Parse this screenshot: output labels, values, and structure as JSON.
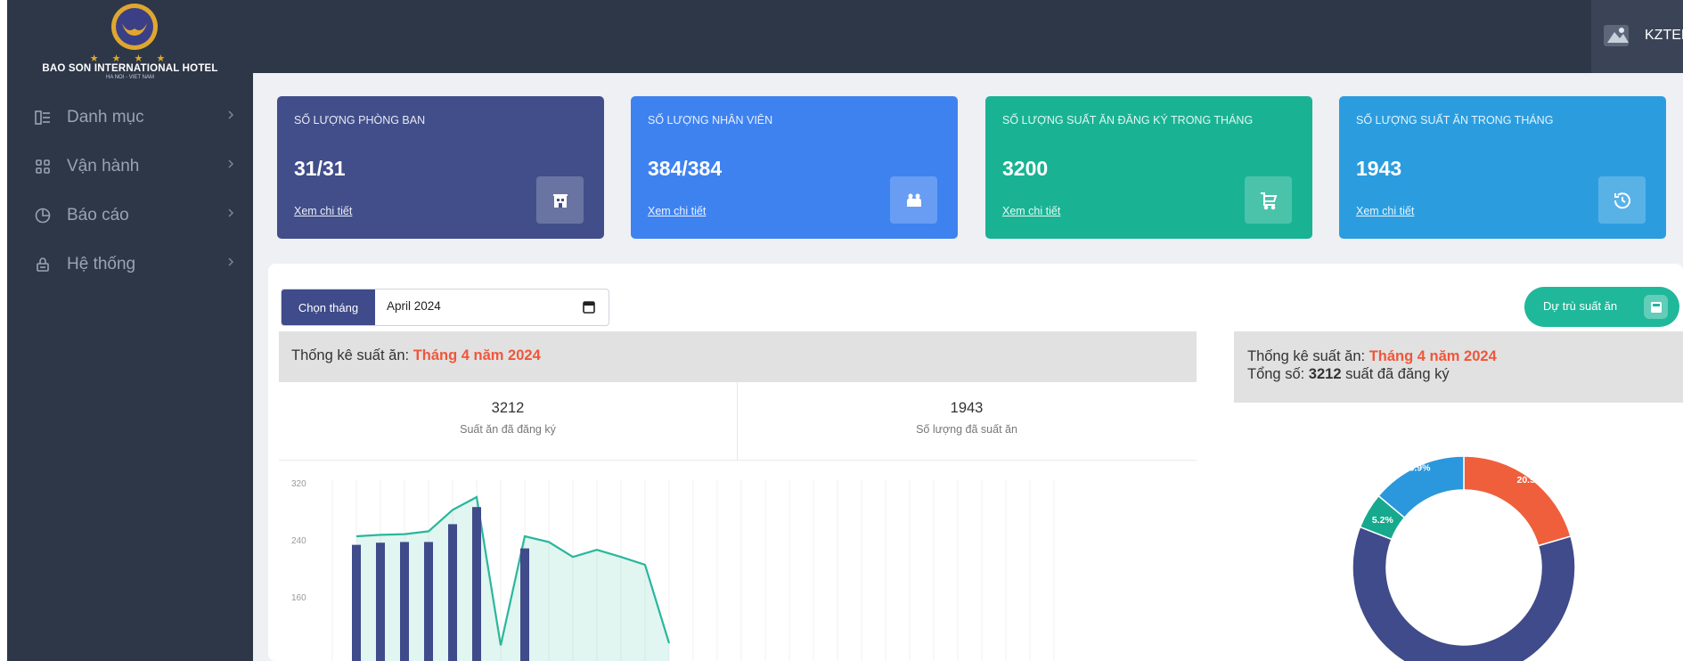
{
  "sidebar": {
    "logo": {
      "name": "BAO SON INTERNATIONAL HOTEL",
      "subtitle": "HA NOI - VIET NAM",
      "stars": "★ ★ ★ ★"
    },
    "items": [
      {
        "label": "Danh mục",
        "icon": "list-icon"
      },
      {
        "label": "Vận hành",
        "icon": "grid-icon"
      },
      {
        "label": "Báo cáo",
        "icon": "pie-chart-icon"
      },
      {
        "label": "Hệ thống",
        "icon": "lock-icon"
      }
    ]
  },
  "topbar": {
    "user_name": "KZTEK"
  },
  "cards": [
    {
      "title": "SỐ LƯỢNG PHÒNG BAN",
      "value": "31/31",
      "link": "Xem chi tiết",
      "icon": "building-icon",
      "color": "#414e8a"
    },
    {
      "title": "SỐ LƯỢNG NHÂN VIÊN",
      "value": "384/384",
      "link": "Xem chi tiết",
      "icon": "people-icon",
      "color": "#3e82f0"
    },
    {
      "title": "SỐ LƯỢNG SUẤT ĂN ĐĂNG KÝ TRONG THÁNG",
      "value": "3200",
      "link": "Xem chi tiết",
      "icon": "cart-icon",
      "color": "#19b394"
    },
    {
      "title": "SỐ LƯỢNG SUẤT ĂN TRONG THÁNG",
      "value": "1943",
      "link": "Xem chi tiết",
      "icon": "history-icon",
      "color": "#2b9ddf"
    }
  ],
  "filter": {
    "label": "Chọn tháng",
    "value": "April 2024"
  },
  "reserve_button": {
    "label": "Dự trù suất ăn"
  },
  "stats": {
    "title_prefix": "Thống kê suất ăn: ",
    "title_highlight": "Tháng 4 năm 2024",
    "registered_value": "3212",
    "registered_label": "Suất ăn đã đăng ký",
    "served_value": "1943",
    "served_label": "Số lượng đã suất ăn"
  },
  "pie_panel": {
    "title_prefix": "Thống kê suất ăn: ",
    "title_highlight": "Tháng 4 năm 2024",
    "total_prefix": "Tổng số: ",
    "total_value": "3212",
    "total_suffix": " suất đã đăng ký"
  },
  "chart_data": [
    {
      "type": "bar",
      "y_ticks": [
        "320",
        "240",
        "160"
      ],
      "ylim": [
        100,
        320
      ],
      "grid": true,
      "series": [
        {
          "type": "bar",
          "color": "#3f4b8a",
          "values": [
            233,
            236,
            237,
            237,
            262,
            286,
            0,
            228
          ]
        },
        {
          "type": "area",
          "color": "#2ab79b",
          "values": [
            null,
            245,
            247,
            248,
            252,
            282,
            300,
            92,
            245,
            237,
            216,
            226,
            216,
            205,
            95
          ]
        }
      ]
    },
    {
      "type": "pie",
      "style": "donut",
      "slices": [
        {
          "label": "20.5%",
          "value": 20.5,
          "color": "#ef5f3c"
        },
        {
          "label": "60.5%",
          "value": 60.5,
          "color": "#3f4b8a"
        },
        {
          "label": "5.2%",
          "value": 5.2,
          "color": "#17a98d"
        },
        {
          "label": "13.9%",
          "value": 13.9,
          "color": "#2b97dc"
        }
      ]
    }
  ]
}
